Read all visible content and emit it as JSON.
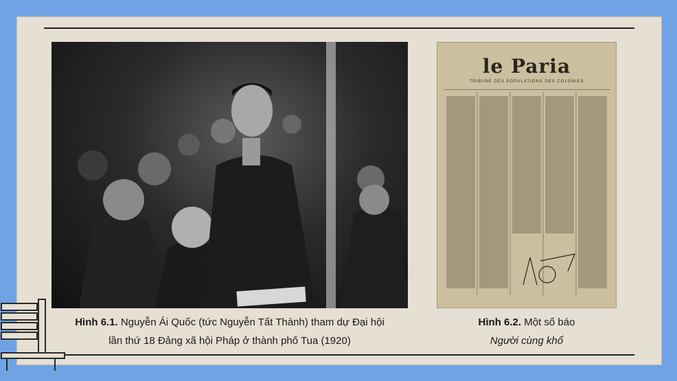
{
  "figure1": {
    "label": "Hình 6.1.",
    "caption_line1": "Nguyễn Ái Quốc (tức Nguyễn Tất Thành) tham dự Đại hội",
    "caption_line2": "lần thứ 18 Đảng xã hội Pháp ở thành phố Tua (1920)"
  },
  "figure2": {
    "label": "Hình 6.2.",
    "caption_line1": "Một số báo",
    "caption_line2": "Người cùng khổ",
    "masthead": "le Paria",
    "subtitle": "TRIBUNE DES POPULATIONS DES COLONIES"
  },
  "colors": {
    "background": "#6fa3e6",
    "slide": "#e6dfd3",
    "paper": "#cbbf9f"
  }
}
